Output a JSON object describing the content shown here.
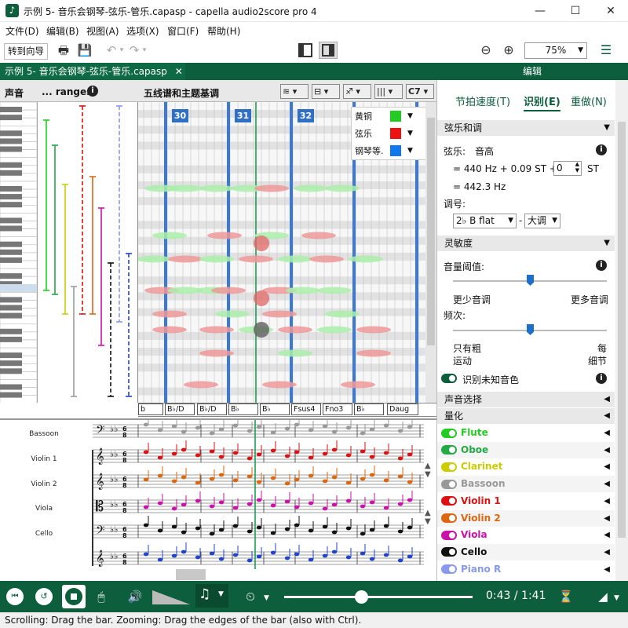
{
  "window": {
    "title": "示例 5- 音乐会钢琴-弦乐-管乐.capasp  - capella audio2score pro 4",
    "minimize": "—",
    "maximize": "☐",
    "close": "✕"
  },
  "menu": [
    "文件(D)",
    "编辑(B)",
    "视图(A)",
    "选项(X)",
    "窗口(F)",
    "帮助(H)"
  ],
  "toolbar": {
    "wizard": "转到向导",
    "zoom": "75%"
  },
  "tab": {
    "doc": "示例 5- 音乐会钢琴-弦乐-管乐.capasp",
    "close": "✕"
  },
  "panel_header": "编辑",
  "columns": {
    "voice": "声音",
    "ranges": "... ranges",
    "staff": "五线谱和主题基调",
    "info": "i"
  },
  "measures": [
    "30",
    "31",
    "32"
  ],
  "legend": [
    {
      "label": "黄铜",
      "color": "#22cc22"
    },
    {
      "label": "弦乐",
      "color": "#ee1111"
    },
    {
      "label": "钢琴等.",
      "color": "#1177ee"
    }
  ],
  "chords": [
    "b",
    "B♭/D",
    "B♭/D",
    "B♭",
    "B♭",
    "Fsus4",
    "Fno3",
    "B♭",
    "Daug"
  ],
  "staff_header": {
    "c7": "C7"
  },
  "instruments_staff": [
    "Bassoon",
    "Violin 1",
    "Violin 2",
    "Viola",
    "Cello"
  ],
  "right_tabs": [
    "节拍速度(T)",
    "识别(E)",
    "重做(N)"
  ],
  "strings_tuning": {
    "section": "弦乐和调",
    "label": "弦乐:",
    "pitch": "音高",
    "freq_line": "= 440 Hz + 0.09 ST +",
    "st_value": "0",
    "st_unit": "ST",
    "result": "= 442.3 Hz",
    "key_label": "调号:",
    "key": "2♭ B flat",
    "dash": "-",
    "mode": "大调"
  },
  "sensitivity": {
    "section": "灵敏度",
    "volume_label": "音量阈值:",
    "volume_left": "更少音调",
    "volume_right": "更多音调",
    "volume_level": 0.5,
    "freq_label": "频次:",
    "freq_left": "只有粗",
    "freq_left2": "运动",
    "freq_right": "每",
    "freq_right2": "细节",
    "freq_level": 0.5,
    "unknown_toggle": "识别未知音色"
  },
  "voice_select": "声音选择",
  "quantize": "量化",
  "instruments": [
    {
      "name": "Flute",
      "color": "#22cc22",
      "on": true
    },
    {
      "name": "Oboe",
      "color": "#22aa44",
      "on": true
    },
    {
      "name": "Clarinet",
      "color": "#cccc00",
      "on": true
    },
    {
      "name": "Bassoon",
      "color": "#999999",
      "on": true
    },
    {
      "name": "Violin 1",
      "color": "#dd1111",
      "on": true
    },
    {
      "name": "Violin 2",
      "color": "#dd6611",
      "on": true
    },
    {
      "name": "Viola",
      "color": "#cc11aa",
      "on": true
    },
    {
      "name": "Cello",
      "color": "#111111",
      "on": true
    },
    {
      "name": "Piano R",
      "color": "#8899ee",
      "on": true
    }
  ],
  "playback": {
    "time": "0:43 / 1:41",
    "progress": 0.41
  },
  "status": "Scrolling: Drag the bar.  Zooming: Drag the edges of the bar (also with Ctrl)."
}
